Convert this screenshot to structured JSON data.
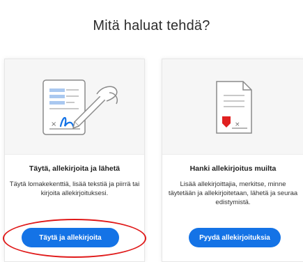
{
  "dialog": {
    "heading": "Mitä haluat tehdä?"
  },
  "cards": [
    {
      "title": "Täytä, allekirjoita ja lähetä",
      "description": "Täytä lomakekenttiä, lisää tekstiä ja piirrä tai kirjoita allekirjoituksesi.",
      "button_label": "Täytä ja allekirjoita",
      "icon": "fill-sign-document-icon"
    },
    {
      "title": "Hanki allekirjoitus muilta",
      "description": "Lisää allekirjoittajia, merkitse, minne täytetään ja allekirjoitetaan, lähetä ja seuraa edistymistä.",
      "button_label": "Pyydä allekirjoituksia",
      "icon": "request-signature-document-icon"
    }
  ],
  "colors": {
    "primary_button": "#1473e6",
    "highlight_ring": "#e01a1a",
    "illustration_bg": "#f6f6f6"
  }
}
